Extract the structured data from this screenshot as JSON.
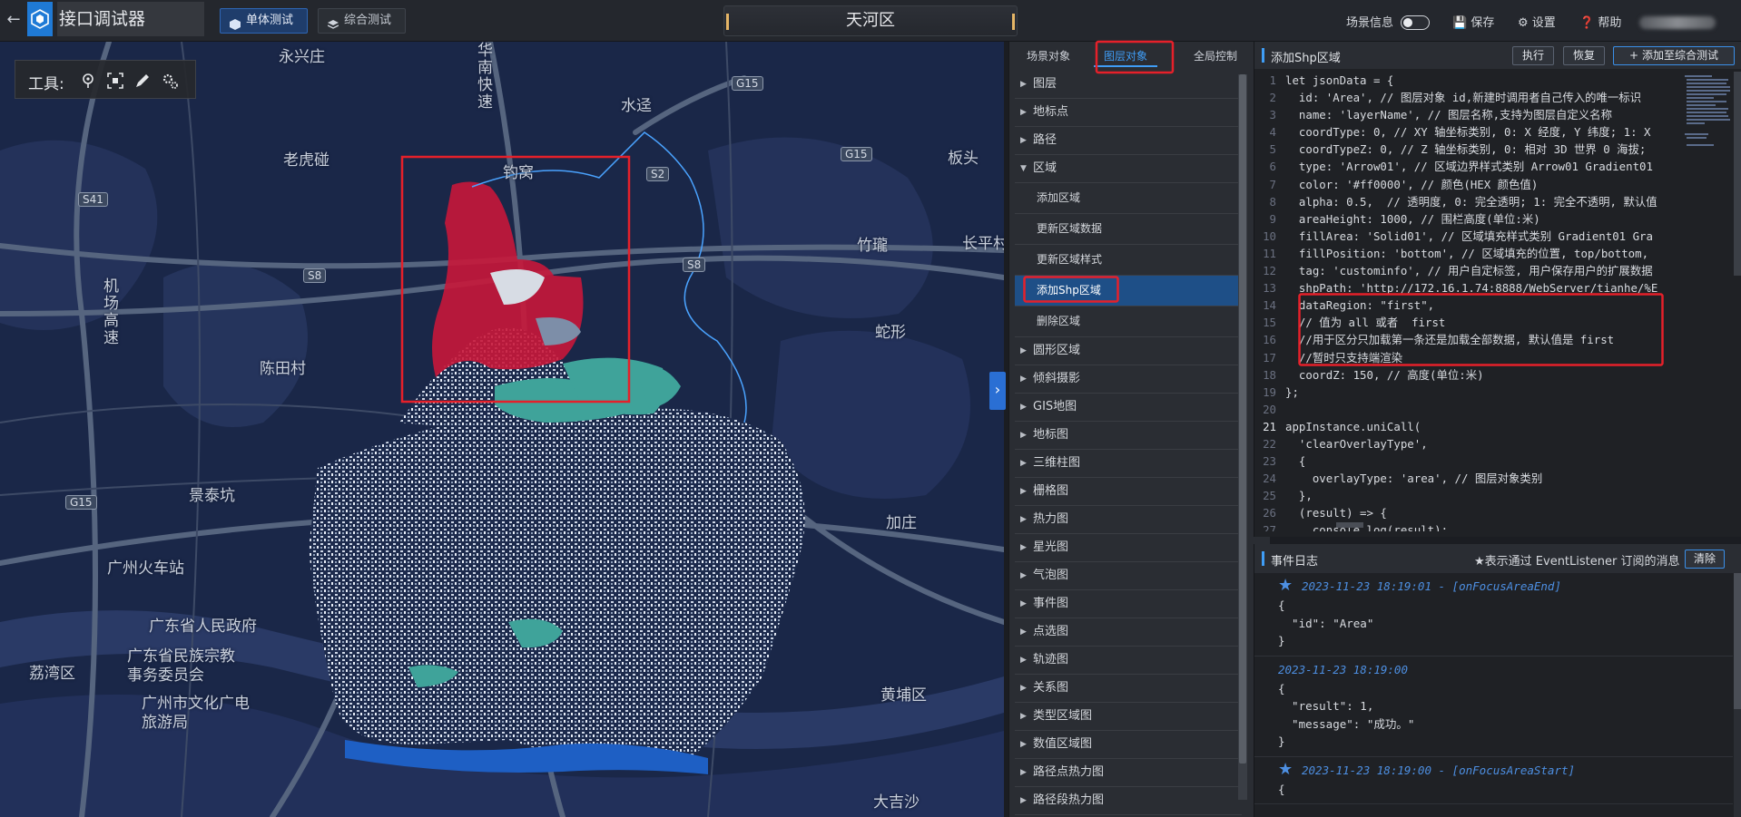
{
  "app": {
    "title": "接口调试器",
    "scene_name": "天河区"
  },
  "header": {
    "mode_tabs": [
      {
        "label": "单体测试",
        "active": true
      },
      {
        "label": "综合测试",
        "active": false
      }
    ],
    "scene_info_label": "场景信息",
    "scene_info_toggle": false,
    "save_label": "保存",
    "settings_label": "设置",
    "help_label": "帮助"
  },
  "map": {
    "toolbox_label": "工具:",
    "tools": [
      "location-pin-icon",
      "focus-frame-icon",
      "pen-icon",
      "gear-cluster-icon"
    ],
    "place_labels": [
      "永兴庄",
      "水迳",
      "老虎碰",
      "钓窝",
      "板头",
      "竹瓏",
      "长平村",
      "蛇形",
      "陈田村",
      "景泰坑",
      "加庄",
      "广州火车站",
      "广东省人民政府",
      "广东省民族宗教事务委员会",
      "荔湾区",
      "广州市文化广电旅游局",
      "黄埔区",
      "大吉沙"
    ],
    "vertical_labels": [
      "华南快速",
      "机场高速"
    ],
    "highway_shields": [
      "G15",
      "S41",
      "S2",
      "G15",
      "S8",
      "S8",
      "G15"
    ]
  },
  "tree": {
    "tabs": [
      {
        "label": "场景对象",
        "active": false
      },
      {
        "label": "图层对象",
        "active": true
      },
      {
        "label": "全局控制",
        "active": false
      }
    ],
    "items": [
      {
        "label": "图层",
        "expanded": false,
        "child": false
      },
      {
        "label": "地标点",
        "expanded": false,
        "child": false
      },
      {
        "label": "路径",
        "expanded": false,
        "child": false
      },
      {
        "label": "区域",
        "expanded": true,
        "child": false
      },
      {
        "label": "添加区域",
        "child": true
      },
      {
        "label": "更新区域数据",
        "child": true
      },
      {
        "label": "更新区域样式",
        "child": true
      },
      {
        "label": "添加Shp区域",
        "child": true,
        "selected": true
      },
      {
        "label": "删除区域",
        "child": true
      },
      {
        "label": "圆形区域",
        "expanded": false,
        "child": false
      },
      {
        "label": "倾斜摄影",
        "expanded": false,
        "child": false
      },
      {
        "label": "GIS地图",
        "expanded": false,
        "child": false
      },
      {
        "label": "地标图",
        "expanded": false,
        "child": false
      },
      {
        "label": "三维柱图",
        "expanded": false,
        "child": false
      },
      {
        "label": "栅格图",
        "expanded": false,
        "child": false
      },
      {
        "label": "热力图",
        "expanded": false,
        "child": false
      },
      {
        "label": "星光图",
        "expanded": false,
        "child": false
      },
      {
        "label": "气泡图",
        "expanded": false,
        "child": false
      },
      {
        "label": "事件图",
        "expanded": false,
        "child": false
      },
      {
        "label": "点选图",
        "expanded": false,
        "child": false
      },
      {
        "label": "轨迹图",
        "expanded": false,
        "child": false
      },
      {
        "label": "关系图",
        "expanded": false,
        "child": false
      },
      {
        "label": "类型区域图",
        "expanded": false,
        "child": false
      },
      {
        "label": "数值区域图",
        "expanded": false,
        "child": false
      },
      {
        "label": "路径点热力图",
        "expanded": false,
        "child": false
      },
      {
        "label": "路径段热力图",
        "expanded": false,
        "child": false
      }
    ]
  },
  "code": {
    "title": "添加Shp区域",
    "run_label": "执行",
    "reset_label": "恢复",
    "add_label": "添加至综合测试",
    "current_line": 21,
    "lines": [
      "let jsonData = {",
      "  id: 'Area', // 图层对象 id,新建时调用者自己传入的唯一标识",
      "  name: 'layerName', // 图层名称,支持为图层自定义名称",
      "  coordType: 0, // XY 轴坐标类别, 0: X 经度, Y 纬度; 1: X",
      "  coordTypeZ: 0, // Z 轴坐标类别, 0: 相对 3D 世界 0 海拔;",
      "  type: 'Arrow01', // 区域边界样式类别 Arrow01 Gradient01",
      "  color: '#ff0000', // 颜色(HEX 颜色值)",
      "  alpha: 0.5,  // 透明度, 0: 完全透明; 1: 完全不透明, 默认值",
      "  areaHeight: 1000, // 围栏高度(单位:米)",
      "  fillArea: 'Solid01', // 区域填充样式类别 Gradient01 Gra",
      "  fillPosition: 'bottom', // 区域填充的位置, top/bottom,",
      "  tag: 'custominfo', // 用户自定标签, 用户保存用户的扩展数据",
      "  shpPath: 'http://172.16.1.74:8888/WebServer/tianhe/%E",
      "  dataRegion: \"first\",",
      "  // 值为 all 或者  first",
      "  //用于区分只加载第一条还是加载全部数据, 默认值是 first",
      "  //暂时只支持端渲染",
      "  coordZ: 150, // 高度(单位:米)",
      "};",
      "",
      "appInstance.uniCall(",
      "  'clearOverlayType',",
      "  {",
      "    overlayType: 'area', // 图层对象类别",
      "  },",
      "  (result) => {",
      "    console.log(result);"
    ]
  },
  "log": {
    "title": "事件日志",
    "hint": "★表示通过 EventListener 订阅的消息",
    "clear_label": "清除",
    "entries": [
      {
        "starred": true,
        "time": "2023-11-23 18:19:01 - [onFocusAreaEnd]",
        "body": "{\n  \"id\": \"Area\"\n}"
      },
      {
        "starred": false,
        "time": "2023-11-23 18:19:00",
        "body": "{\n  \"result\": 1,\n  \"message\": \"成功。\"\n}"
      },
      {
        "starred": true,
        "time": "2023-11-23 18:19:00 - [onFocusAreaStart]",
        "body": "{"
      }
    ]
  },
  "colors": {
    "accent": "#3f9df6",
    "highlight_box": "#e5202a",
    "area_fill": "#c8173a",
    "map_bg": "#1a2748"
  }
}
